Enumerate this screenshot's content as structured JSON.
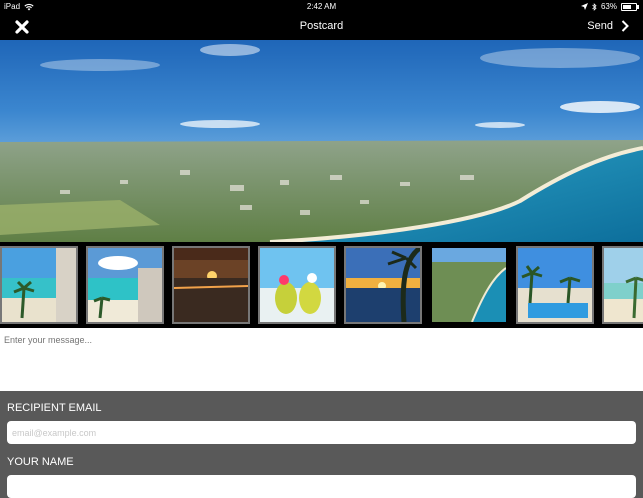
{
  "status_bar": {
    "device": "iPad",
    "time": "2:42 AM",
    "battery": "63%",
    "battery_level": 0.63
  },
  "nav": {
    "title": "Postcard",
    "send_label": "Send"
  },
  "thumbnails": [
    "beach-balcony-photo",
    "beach-balcony-photo",
    "sunset-sea-photo",
    "coconut-drinks-photo",
    "palm-sunset-photo",
    "coastline-aerial-photo",
    "pool-palms-photo",
    "beach-palms-photo"
  ],
  "message": {
    "placeholder": "Enter your message..."
  },
  "form": {
    "recipient_label": "RECIPIENT EMAIL",
    "recipient_placeholder": "email@example.com",
    "name_label": "YOUR NAME"
  }
}
